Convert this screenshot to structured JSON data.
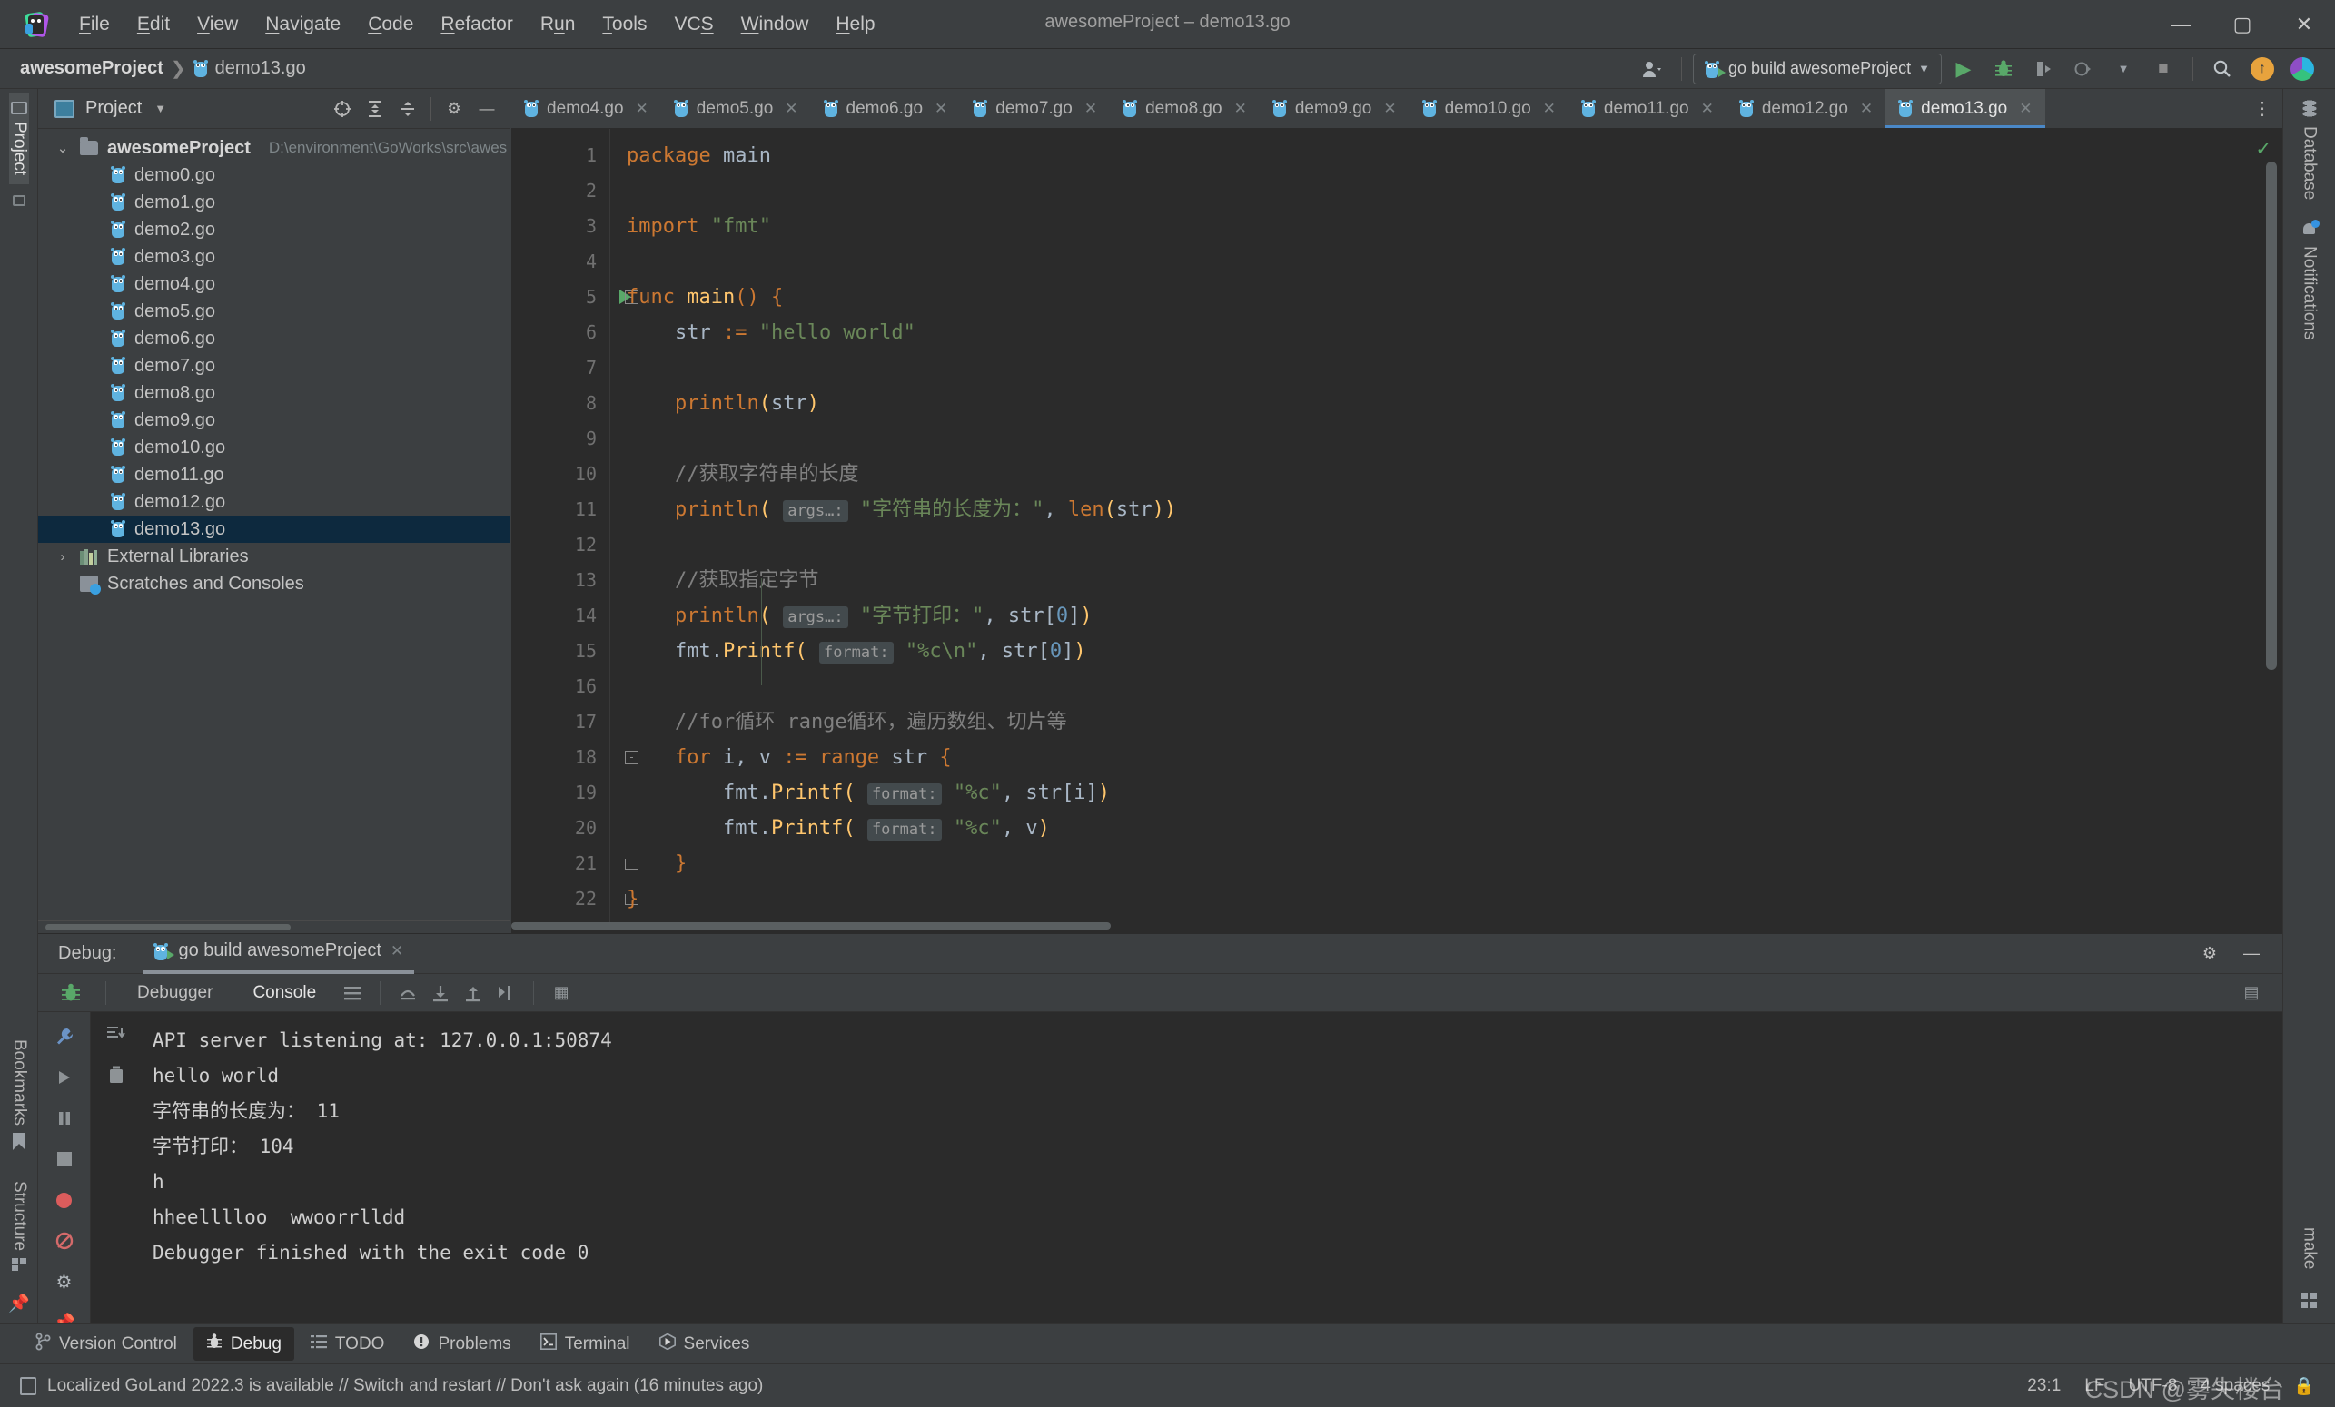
{
  "window": {
    "title": "awesomeProject – demo13.go",
    "minimize": "—",
    "maximize": "▢",
    "close": "✕"
  },
  "menu": [
    "File",
    "Edit",
    "View",
    "Navigate",
    "Code",
    "Refactor",
    "Run",
    "Tools",
    "VCS",
    "Window",
    "Help"
  ],
  "breadcrumb": {
    "project": "awesomeProject",
    "separator": "❯",
    "file": "demo13.go"
  },
  "toolbar": {
    "account_icon": "account-icon",
    "run_config": "go build awesomeProject",
    "run_label": "▶",
    "debug_label": "bug",
    "coverage_label": "coverage",
    "profile_label": "profile",
    "stop_label": "■",
    "search_label": "🔍",
    "update_label": "↑",
    "ai_label": "ai"
  },
  "left_strip": {
    "project_label": "Project",
    "bookmarks_label": "Bookmarks",
    "structure_label": "Structure"
  },
  "right_strip": {
    "database_label": "Database",
    "notifications_label": "Notifications",
    "make_label": "make"
  },
  "project_panel": {
    "title": "Project",
    "chevron": "▼",
    "tools": [
      "⊕",
      "⤒",
      "⤓",
      "⚙",
      "—"
    ],
    "tree": [
      {
        "label": "awesomeProject",
        "path": "D:\\environment\\GoWorks\\src\\awes",
        "type": "folder",
        "depth": 0,
        "twisty": "⌄",
        "bold": true,
        "selected": false
      },
      {
        "label": "demo0.go",
        "type": "go",
        "depth": 1,
        "selected": false
      },
      {
        "label": "demo1.go",
        "type": "go",
        "depth": 1,
        "selected": false
      },
      {
        "label": "demo2.go",
        "type": "go",
        "depth": 1,
        "selected": false
      },
      {
        "label": "demo3.go",
        "type": "go",
        "depth": 1,
        "selected": false
      },
      {
        "label": "demo4.go",
        "type": "go",
        "depth": 1,
        "selected": false
      },
      {
        "label": "demo5.go",
        "type": "go",
        "depth": 1,
        "selected": false
      },
      {
        "label": "demo6.go",
        "type": "go",
        "depth": 1,
        "selected": false
      },
      {
        "label": "demo7.go",
        "type": "go",
        "depth": 1,
        "selected": false
      },
      {
        "label": "demo8.go",
        "type": "go",
        "depth": 1,
        "selected": false
      },
      {
        "label": "demo9.go",
        "type": "go",
        "depth": 1,
        "selected": false
      },
      {
        "label": "demo10.go",
        "type": "go",
        "depth": 1,
        "selected": false
      },
      {
        "label": "demo11.go",
        "type": "go",
        "depth": 1,
        "selected": false
      },
      {
        "label": "demo12.go",
        "type": "go",
        "depth": 1,
        "selected": false
      },
      {
        "label": "demo13.go",
        "type": "go",
        "depth": 1,
        "selected": true
      },
      {
        "label": "External Libraries",
        "type": "lib",
        "depth": 0,
        "twisty": "›",
        "selected": false
      },
      {
        "label": "Scratches and Consoles",
        "type": "scratch",
        "depth": 0,
        "selected": false
      }
    ]
  },
  "editor": {
    "tabs": [
      {
        "label": "demo4.go",
        "active": false,
        "close": "✕"
      },
      {
        "label": "demo5.go",
        "active": false,
        "close": "✕"
      },
      {
        "label": "demo6.go",
        "active": false,
        "close": "✕"
      },
      {
        "label": "demo7.go",
        "active": false,
        "close": "✕"
      },
      {
        "label": "demo8.go",
        "active": false,
        "close": "✕"
      },
      {
        "label": "demo9.go",
        "active": false,
        "close": "✕"
      },
      {
        "label": "demo10.go",
        "active": false,
        "close": "✕"
      },
      {
        "label": "demo11.go",
        "active": false,
        "close": "✕"
      },
      {
        "label": "demo12.go",
        "active": false,
        "close": "✕"
      },
      {
        "label": "demo13.go",
        "active": true,
        "close": "✕"
      }
    ],
    "tab_overflow": "⋮",
    "inspection_ok": "✓",
    "lines": [
      {
        "n": "1",
        "tokens": [
          {
            "t": "package ",
            "c": "kw"
          },
          {
            "t": "main",
            "c": "var"
          }
        ]
      },
      {
        "n": "2",
        "tokens": []
      },
      {
        "n": "3",
        "tokens": [
          {
            "t": "import ",
            "c": "kw"
          },
          {
            "t": "\"fmt\"",
            "c": "str"
          }
        ]
      },
      {
        "n": "4",
        "tokens": []
      },
      {
        "n": "5",
        "runmark": true,
        "fold": "-",
        "tokens": [
          {
            "t": "func ",
            "c": "kw"
          },
          {
            "t": "main",
            "c": "fn"
          },
          {
            "t": "() ",
            "c": "brc"
          },
          {
            "t": "{",
            "c": "brc"
          }
        ]
      },
      {
        "n": "6",
        "tokens": [
          {
            "t": "    str ",
            "c": "var"
          },
          {
            "t": ":= ",
            "c": "kw"
          },
          {
            "t": "\"hello world\"",
            "c": "str"
          }
        ]
      },
      {
        "n": "7",
        "tokens": []
      },
      {
        "n": "8",
        "tokens": [
          {
            "t": "    ",
            "c": "var"
          },
          {
            "t": "println",
            "c": "kw"
          },
          {
            "t": "(",
            "c": "fn"
          },
          {
            "t": "str",
            "c": "var"
          },
          {
            "t": ")",
            "c": "fn"
          }
        ]
      },
      {
        "n": "9",
        "tokens": []
      },
      {
        "n": "10",
        "tokens": [
          {
            "t": "    //获取字符串的长度",
            "c": "cmt"
          }
        ]
      },
      {
        "n": "11",
        "tokens": [
          {
            "t": "    ",
            "c": "var"
          },
          {
            "t": "println",
            "c": "kw"
          },
          {
            "t": "( ",
            "c": "fn"
          },
          {
            "t": "args…:",
            "c": "hint"
          },
          {
            "t": " \"字符串的长度为：\"",
            "c": "str"
          },
          {
            "t": ", ",
            "c": "var"
          },
          {
            "t": "len",
            "c": "kw"
          },
          {
            "t": "(",
            "c": "fn"
          },
          {
            "t": "str",
            "c": "var"
          },
          {
            "t": "))",
            "c": "fn"
          }
        ]
      },
      {
        "n": "12",
        "tokens": []
      },
      {
        "n": "13",
        "tokens": [
          {
            "t": "    //获取指定字节",
            "c": "cmt"
          }
        ]
      },
      {
        "n": "14",
        "tokens": [
          {
            "t": "    ",
            "c": "var"
          },
          {
            "t": "println",
            "c": "kw"
          },
          {
            "t": "( ",
            "c": "fn"
          },
          {
            "t": "args…:",
            "c": "hint"
          },
          {
            "t": " \"字节打印：\"",
            "c": "str"
          },
          {
            "t": ", ",
            "c": "var"
          },
          {
            "t": "str[",
            "c": "var"
          },
          {
            "t": "0",
            "c": "num"
          },
          {
            "t": "]",
            "c": "var"
          },
          {
            "t": ")",
            "c": "fn"
          }
        ]
      },
      {
        "n": "15",
        "tokens": [
          {
            "t": "    fmt.",
            "c": "var"
          },
          {
            "t": "Printf",
            "c": "fn"
          },
          {
            "t": "( ",
            "c": "fn"
          },
          {
            "t": "format:",
            "c": "hint"
          },
          {
            "t": " \"%c\\n\"",
            "c": "str"
          },
          {
            "t": ", ",
            "c": "var"
          },
          {
            "t": "str[",
            "c": "var"
          },
          {
            "t": "0",
            "c": "num"
          },
          {
            "t": "]",
            "c": "var"
          },
          {
            "t": ")",
            "c": "fn"
          }
        ]
      },
      {
        "n": "16",
        "tokens": []
      },
      {
        "n": "17",
        "tokens": [
          {
            "t": "    //for循环 range循环，遍历数组、切片等",
            "c": "cmt"
          }
        ]
      },
      {
        "n": "18",
        "fold": "-",
        "tokens": [
          {
            "t": "    ",
            "c": "var"
          },
          {
            "t": "for ",
            "c": "kw"
          },
          {
            "t": "i, v ",
            "c": "var"
          },
          {
            "t": ":= ",
            "c": "kw"
          },
          {
            "t": "range ",
            "c": "kw"
          },
          {
            "t": "str ",
            "c": "var"
          },
          {
            "t": "{",
            "c": "brc"
          }
        ]
      },
      {
        "n": "19",
        "tokens": [
          {
            "t": "        fmt.",
            "c": "var"
          },
          {
            "t": "Printf",
            "c": "fn"
          },
          {
            "t": "( ",
            "c": "fn"
          },
          {
            "t": "format:",
            "c": "hint"
          },
          {
            "t": " \"%c\"",
            "c": "str"
          },
          {
            "t": ", ",
            "c": "var"
          },
          {
            "t": "str[i]",
            "c": "var"
          },
          {
            "t": ")",
            "c": "fn"
          }
        ]
      },
      {
        "n": "20",
        "tokens": [
          {
            "t": "        fmt.",
            "c": "var"
          },
          {
            "t": "Printf",
            "c": "fn"
          },
          {
            "t": "( ",
            "c": "fn"
          },
          {
            "t": "format:",
            "c": "hint"
          },
          {
            "t": " \"%c\"",
            "c": "str"
          },
          {
            "t": ", ",
            "c": "var"
          },
          {
            "t": "v",
            "c": "var"
          },
          {
            "t": ")",
            "c": "fn"
          }
        ]
      },
      {
        "n": "21",
        "foldEnd": true,
        "tokens": [
          {
            "t": "    ",
            "c": "var"
          },
          {
            "t": "}",
            "c": "brc"
          }
        ]
      },
      {
        "n": "22",
        "foldEnd": true,
        "tokens": [
          {
            "t": "}",
            "c": "brc"
          }
        ]
      }
    ]
  },
  "debug": {
    "label": "Debug:",
    "session_tab": "go build awesomeProject",
    "session_close": "✕",
    "settings_icon": "⚙",
    "hide_icon": "—",
    "subtabs": [
      {
        "label": "Debugger",
        "active": false
      },
      {
        "label": "Console",
        "active": true
      }
    ],
    "toolbar_icons": [
      "≡",
      "⤴",
      "⤓",
      "⤒",
      "⇥"
    ],
    "calculator_icon": "▦",
    "layout_icon": "▤",
    "side_icons": [
      "wrench",
      "play",
      "pause",
      "stop",
      "breakpoint",
      "mute-breakpoints",
      "settings",
      "pin"
    ],
    "console_side_icons": [
      "scroll-to-end",
      "trash"
    ],
    "console_lines": [
      "API server listening at: 127.0.0.1:50874",
      "hello world",
      "字符串的长度为： 11",
      "字节打印： 104",
      "h",
      "hheelllloo  wwoorrlldd",
      "Debugger finished with the exit code 0"
    ]
  },
  "bottom_bar": [
    {
      "label": "Version Control",
      "icon": "⑂",
      "active": false
    },
    {
      "label": "Debug",
      "icon": "bug",
      "active": true
    },
    {
      "label": "TODO",
      "icon": "☰",
      "active": false
    },
    {
      "label": "Problems",
      "icon": "❶",
      "active": false
    },
    {
      "label": "Terminal",
      "icon": "▣",
      "active": false
    },
    {
      "label": "Services",
      "icon": "◑",
      "active": false
    }
  ],
  "status_bar": {
    "message": "Localized GoLand 2022.3 is available // Switch and restart // Don't ask again (16 minutes ago)",
    "caret": "23:1",
    "line_sep": "LF",
    "encoding": "UTF-8",
    "indent": "4 spaces",
    "lock": "🔒"
  },
  "watermark": "CSDN @雾失楼台"
}
